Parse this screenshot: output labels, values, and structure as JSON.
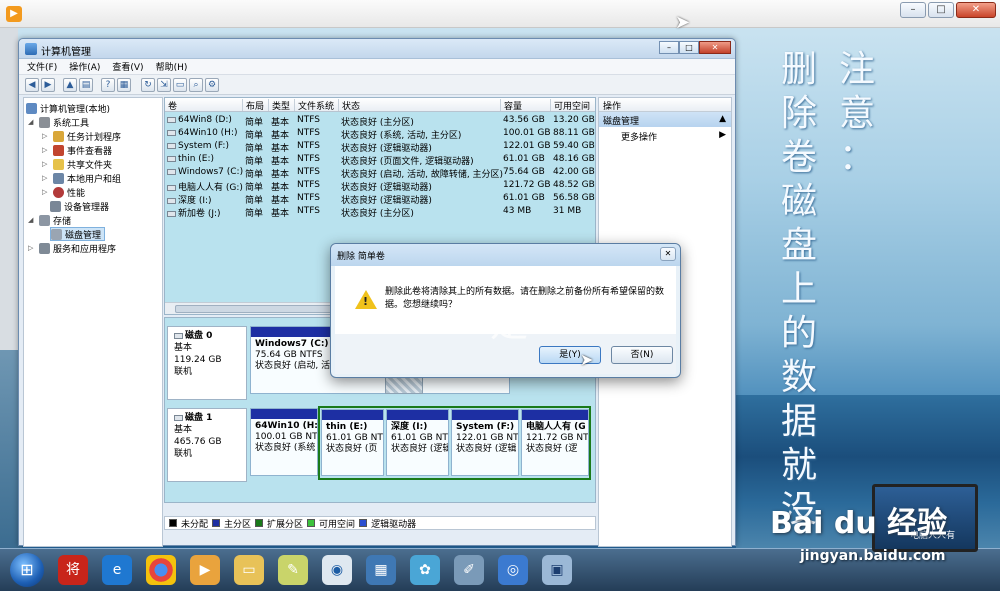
{
  "caption": {
    "col1": [
      "删",
      "除",
      "卷",
      "磁",
      "盘",
      "上",
      "的",
      "数",
      "据",
      "就",
      "没"
    ],
    "col2": [
      "注",
      "意",
      "："
    ]
  },
  "window": {
    "title": "计算机管理",
    "menu": [
      "文件(F)",
      "操作(A)",
      "查看(V)",
      "帮助(H)"
    ]
  },
  "tree": {
    "root": "计算机管理(本地)",
    "system_tools": "系统工具",
    "task_scheduler": "任务计划程序",
    "event_viewer": "事件查看器",
    "shared_folders": "共享文件夹",
    "local_users": "本地用户和组",
    "performance": "性能",
    "device_manager": "设备管理器",
    "storage": "存储",
    "disk_management": "磁盘管理",
    "services": "服务和应用程序"
  },
  "volumes": {
    "headers": [
      "卷",
      "布局",
      "类型",
      "文件系统",
      "状态",
      "容量",
      "可用空间"
    ],
    "rows": [
      [
        "64Win8 (D:)",
        "简单",
        "基本",
        "NTFS",
        "状态良好 (主分区)",
        "43.56 GB",
        "13.20 GB"
      ],
      [
        "64Win10 (H:)",
        "简单",
        "基本",
        "NTFS",
        "状态良好 (系统, 活动, 主分区)",
        "100.01 GB",
        "88.11 GB"
      ],
      [
        "System (F:)",
        "简单",
        "基本",
        "NTFS",
        "状态良好 (逻辑驱动器)",
        "122.01 GB",
        "59.40 GB"
      ],
      [
        "thin (E:)",
        "简单",
        "基本",
        "NTFS",
        "状态良好 (页面文件, 逻辑驱动器)",
        "61.01 GB",
        "48.16 GB"
      ],
      [
        "Windows7 (C:)",
        "简单",
        "基本",
        "NTFS",
        "状态良好 (启动, 活动, 故障转储, 主分区)",
        "75.64 GB",
        "42.00 GB"
      ],
      [
        "电脑人人有 (G:)",
        "简单",
        "基本",
        "NTFS",
        "状态良好 (逻辑驱动器)",
        "121.72 GB",
        "48.52 GB"
      ],
      [
        "深度 (I:)",
        "简单",
        "基本",
        "NTFS",
        "状态良好 (逻辑驱动器)",
        "61.01 GB",
        "56.58 GB"
      ],
      [
        "新加卷 (J:)",
        "简单",
        "基本",
        "NTFS",
        "状态良好 (主分区)",
        "43 MB",
        "31 MB"
      ]
    ]
  },
  "disks": {
    "disk0": {
      "name": "磁盘 0",
      "type": "基本",
      "size": "119.24 GB",
      "status": "联机",
      "parts": [
        {
          "name": "Windows7  (C:)",
          "size": "75.64 GB NTFS",
          "status": "状态良好 (启动, 活动"
        }
      ]
    },
    "disk1": {
      "name": "磁盘 1",
      "type": "基本",
      "size": "465.76 GB",
      "status": "联机",
      "parts": [
        {
          "name": "64Win10  (H:",
          "size": "100.01 GB NT",
          "status": "状态良好 (系统"
        },
        {
          "name": "thin  (E:)",
          "size": "61.01 GB NT",
          "status": "状态良好 (页"
        },
        {
          "name": "深度  (I:)",
          "size": "61.01 GB NT",
          "status": "状态良好 (逻辑"
        },
        {
          "name": "System  (F:)",
          "size": "122.01 GB NT",
          "status": "状态良好 (逻辑"
        },
        {
          "name": "电脑人人有  (G",
          "size": "121.72 GB NT",
          "status": "状态良好 (逻"
        }
      ]
    }
  },
  "legend": [
    {
      "label": "未分配",
      "color": "#000000"
    },
    {
      "label": "主分区",
      "color": "#1d2fa3"
    },
    {
      "label": "扩展分区",
      "color": "#1a7a1a"
    },
    {
      "label": "可用空间",
      "color": "#3cc23c"
    },
    {
      "label": "逻辑驱动器",
      "color": "#2b4fd1"
    }
  ],
  "actions": {
    "header": "操作",
    "section": "磁盘管理",
    "more": "更多操作"
  },
  "dialog": {
    "title": "删除 简单卷",
    "message": "删除此卷将清除其上的所有数据。请在删除之前备份所有希望保留的数据。您想继续吗？",
    "yes": "是(Y)",
    "no": "否(N)",
    "overlay_text": "是"
  },
  "watermark": {
    "brand": "Bai du 经验",
    "url": "jingyan.baidu.com",
    "laptop_text": "电脑人人有"
  },
  "taskbar_items": [
    "start",
    "jiang-app",
    "ie",
    "chrome",
    "media-player",
    "folder",
    "notes",
    "disk-tool",
    "network",
    "flower",
    "paint",
    "media-center",
    "computer-management"
  ]
}
